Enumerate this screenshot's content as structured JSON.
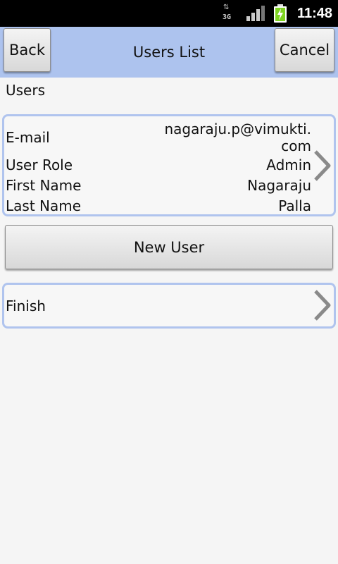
{
  "status_bar": {
    "network": "3G",
    "time": "11:48",
    "icons": [
      "data-arrows-icon",
      "signal-icon",
      "battery-charging-icon"
    ]
  },
  "header": {
    "back_label": "Back",
    "title": "Users List",
    "cancel_label": "Cancel",
    "background_color": "#adc3ee"
  },
  "section_label": "Users",
  "user": {
    "email_label": "E-mail",
    "email_value": "nagaraju.p@vimukti.com",
    "role_label": "User Role",
    "role_value": "Admin",
    "first_name_label": "First Name",
    "first_name_value": "Nagaraju",
    "last_name_label": "Last Name",
    "last_name_value": "Palla"
  },
  "new_user_label": "New User",
  "finish_label": "Finish",
  "accent_color": "#b0c4ee"
}
